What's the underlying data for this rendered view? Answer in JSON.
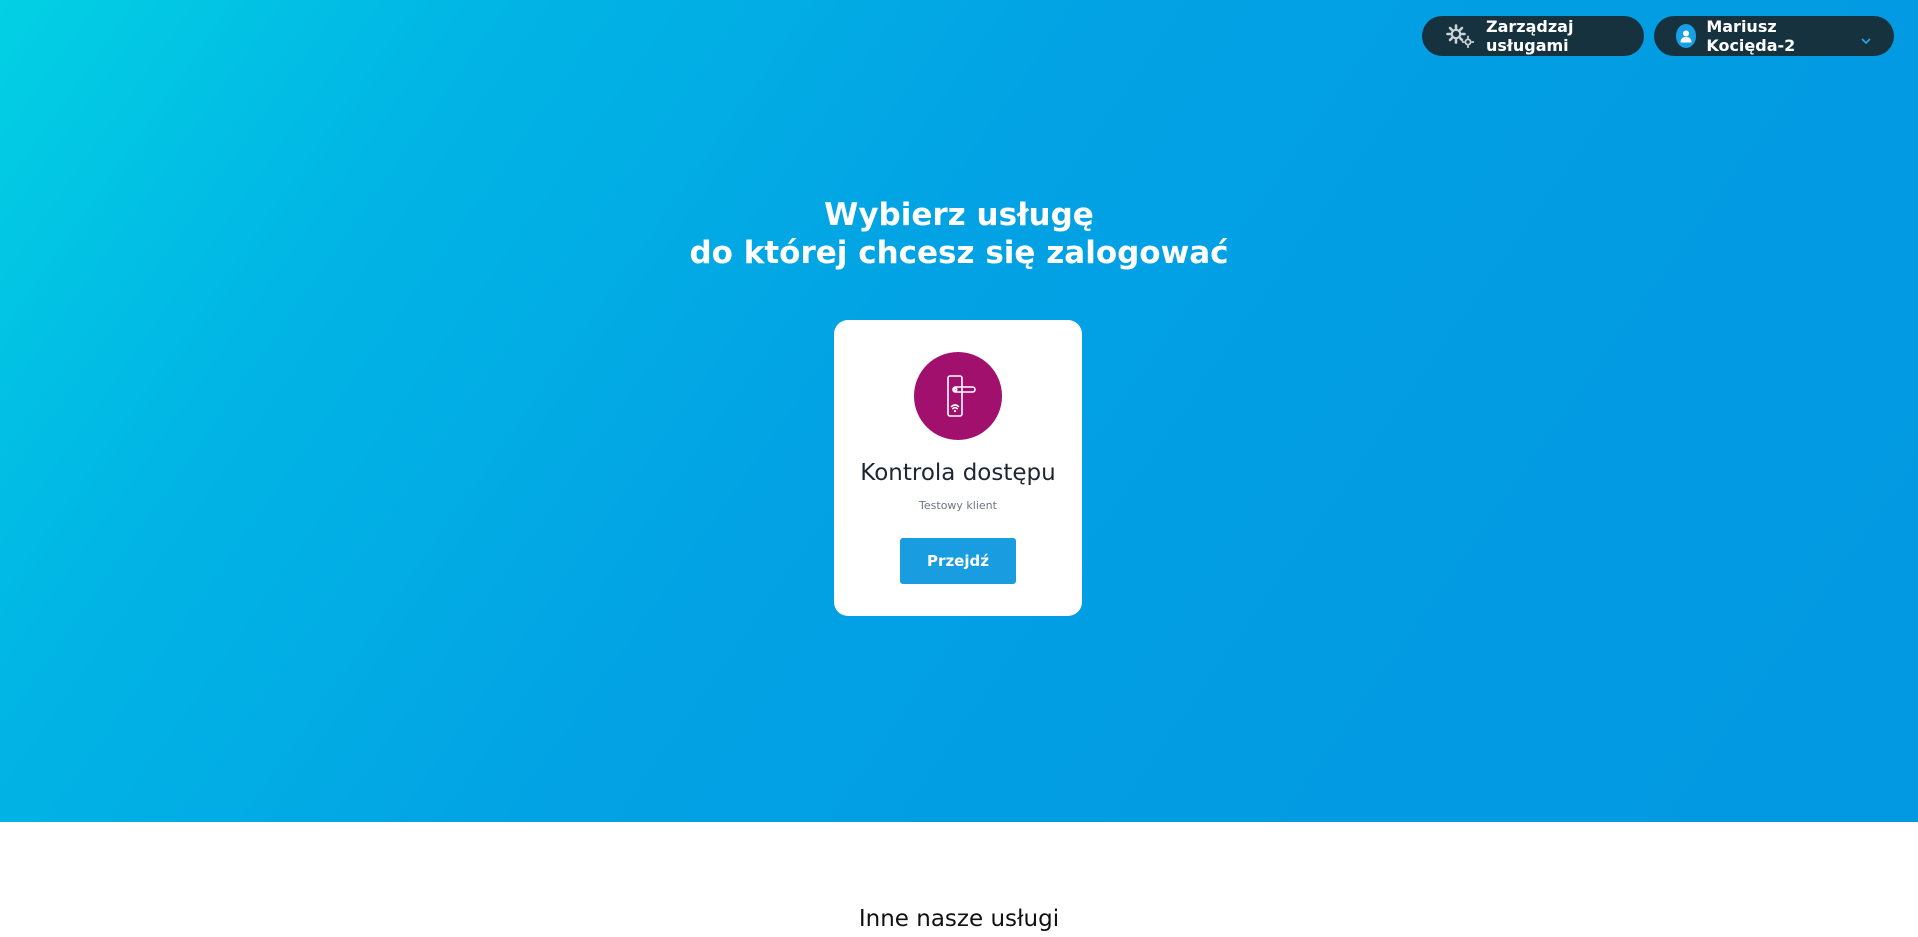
{
  "header": {
    "manage_label": "Zarządzaj usługami",
    "user_name": "Mariusz Kocięda-2",
    "icons": {
      "manage": "gears-icon",
      "user": "user-avatar-icon",
      "dropdown": "chevron-down-icon"
    }
  },
  "hero": {
    "title_line1": "Wybierz usługę",
    "title_line2": "do której chcesz się zalogować"
  },
  "service_card": {
    "icon": "door-handle-wifi-icon",
    "title": "Kontrola dostępu",
    "subtitle": "Testowy klient",
    "button_label": "Przejdź"
  },
  "other_services": {
    "heading": "Inne nasze usługi"
  },
  "colors": {
    "hero_gradient_start": "#02d0e4",
    "hero_gradient_end": "#0398e2",
    "pill_bg": "#17323f",
    "service_icon_bg": "#a1106c",
    "button_bg": "#1a9de0"
  }
}
